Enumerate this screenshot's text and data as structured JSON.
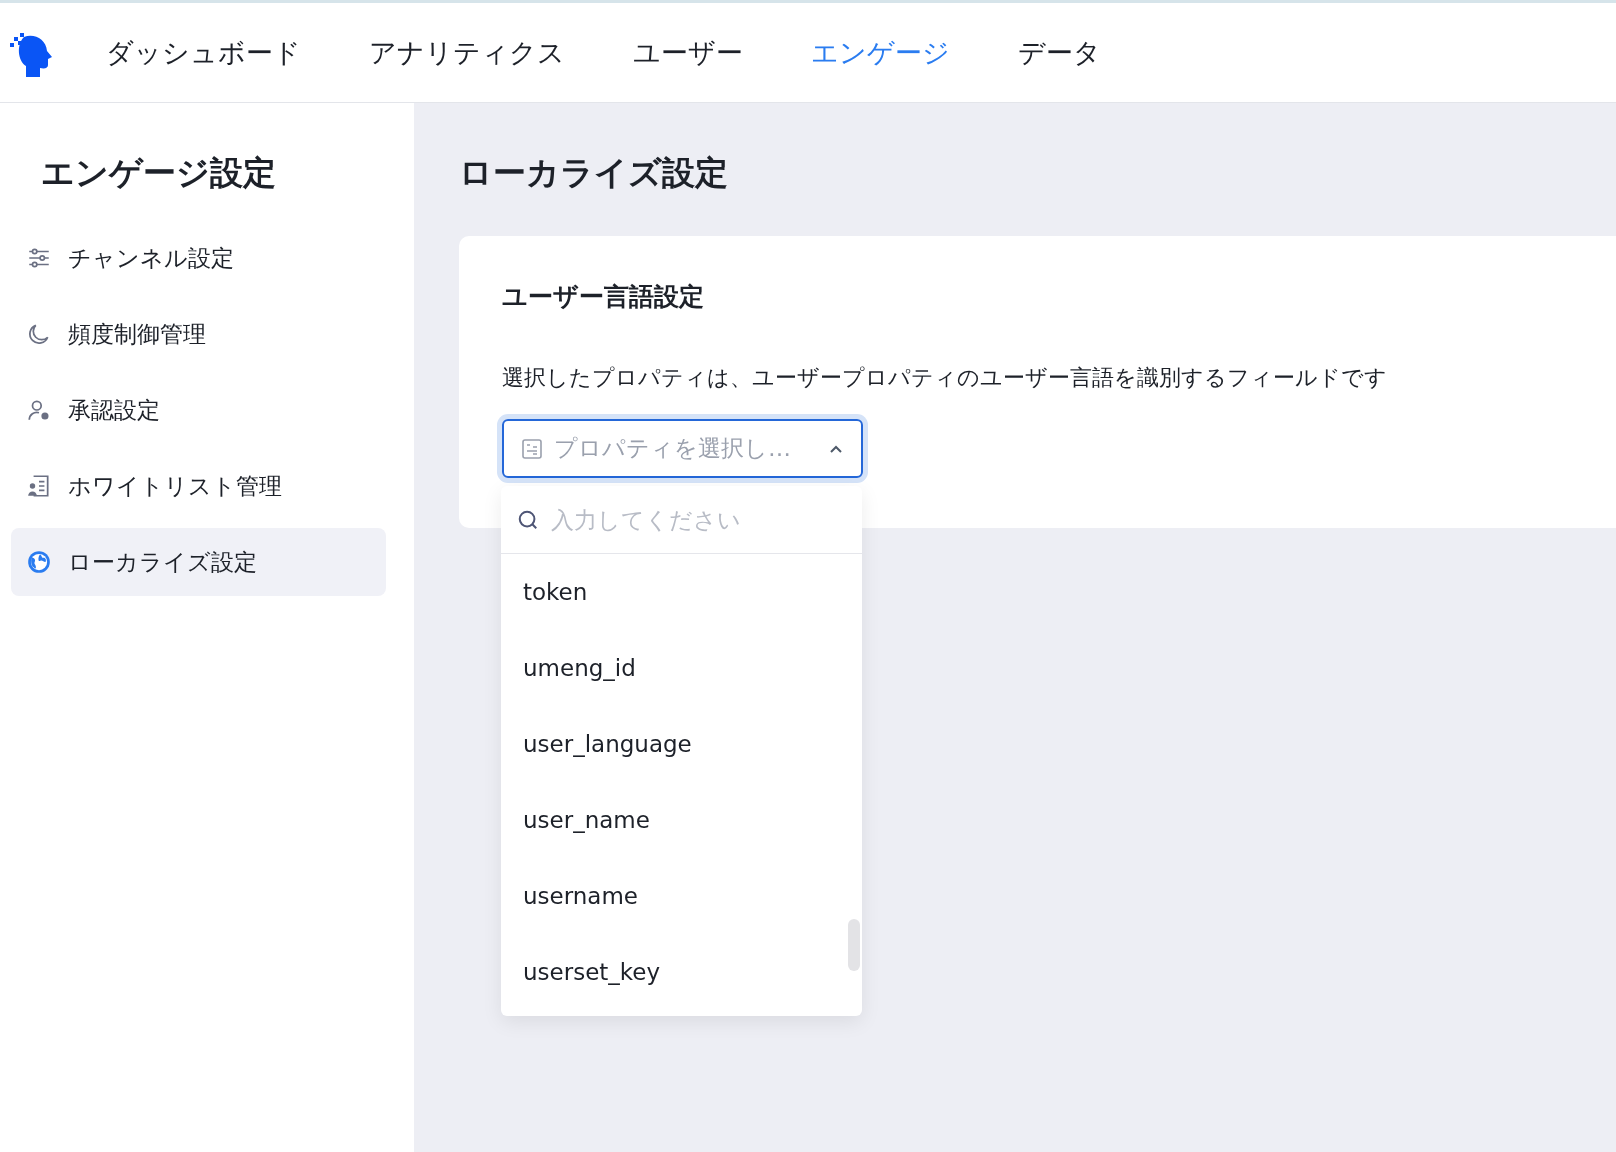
{
  "nav": {
    "items": [
      {
        "label": "ダッシュボード",
        "selected": false
      },
      {
        "label": "アナリティクス",
        "selected": false
      },
      {
        "label": "ユーザー",
        "selected": false
      },
      {
        "label": "エンゲージ",
        "selected": true
      },
      {
        "label": "データ",
        "selected": false
      }
    ]
  },
  "sidebar": {
    "title": "エンゲージ設定",
    "items": [
      {
        "label": "チャンネル設定",
        "selected": false
      },
      {
        "label": "頻度制御管理",
        "selected": false
      },
      {
        "label": "承認設定",
        "selected": false
      },
      {
        "label": "ホワイトリスト管理",
        "selected": false
      },
      {
        "label": "ローカライズ設定",
        "selected": true
      }
    ]
  },
  "page_title": "ローカライズ設定",
  "card": {
    "title": "ユーザー言語設定",
    "description": "選択したプロパティは、ユーザープロパティのユーザー言語を識別するフィールドです",
    "select": {
      "placeholder": "プロパティを選択し…",
      "expanded": true
    },
    "dropdown": {
      "search_placeholder": "入力してください",
      "options": [
        "token",
        "umeng_id",
        "user_language",
        "user_name",
        "username",
        "userset_key"
      ]
    }
  }
}
